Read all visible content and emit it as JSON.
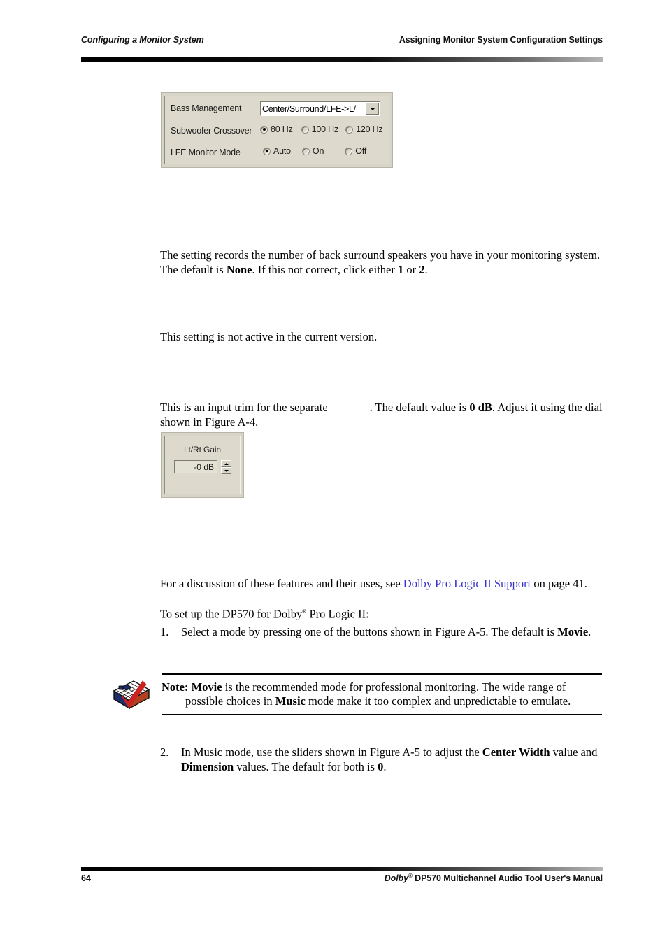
{
  "header": {
    "left": "Configuring a Monitor System",
    "right": "Assigning Monitor System Configuration Settings"
  },
  "footer": {
    "page_number": "64",
    "brand": "Dolby",
    "registered_mark": "®",
    "manual_title": " DP570 Multichannel Audio Tool User's Manual"
  },
  "bass_dialog": {
    "name": "bass-management-dialog",
    "rows": [
      {
        "label": "Bass Management",
        "control": "dropdown",
        "value": "Center/Surround/LFE->L/"
      },
      {
        "label": "Subwoofer Crossover",
        "control": "radio-group",
        "options": [
          {
            "label": "80 Hz",
            "checked": true
          },
          {
            "label": "100 Hz",
            "checked": false
          },
          {
            "label": "120 Hz",
            "checked": false
          }
        ]
      },
      {
        "label": "LFE Monitor Mode",
        "control": "radio-group",
        "options": [
          {
            "label": "Auto",
            "checked": true
          },
          {
            "label": "On",
            "checked": false
          },
          {
            "label": "Off",
            "checked": false
          }
        ]
      }
    ]
  },
  "gain_dialog": {
    "name": "lt-rt-gain-dialog",
    "caption": "Lt/Rt Gain",
    "value": "-0 dB",
    "spinner_up": "▲",
    "spinner_down": "▼"
  },
  "paragraphs": {
    "back_surround": {
      "seg1": "The setting records the number of back surround speakers you have in your monitoring system. The default is ",
      "bold1": "None",
      "seg2": ". If this not correct, click either ",
      "bold2": "1",
      "seg3": " or ",
      "bold3": "2",
      "seg4": "."
    },
    "not_active": "This setting is not active in the current version.",
    "input_trim": {
      "seg1": "This is an input trim for the separate",
      "seg2": ". The default value is ",
      "bold1": "0 dB",
      "seg3": ". Adjust it using the dial shown in Figure A-4."
    },
    "discussion": {
      "seg1": "For a discussion of these features and their uses, see ",
      "link": "Dolby Pro Logic II Support",
      "seg2": " on page 41."
    },
    "setup_intro": {
      "seg1": "To set up the DP570 for Dolby",
      "sup": "®",
      "seg2": " Pro Logic II:"
    }
  },
  "steps": [
    {
      "marker": "1.",
      "seg1": "Select a mode by pressing one of the buttons shown in Figure A-5. The default is ",
      "bold1": "Movie",
      "seg2": "."
    },
    {
      "marker": "2.",
      "seg1": "In Music mode, use the sliders shown in Figure A-5 to adjust the ",
      "bold1": "Center Width",
      "seg2": " value and ",
      "bold2": "Dimension",
      "seg3": " values. The default for both is ",
      "bold3": "0",
      "seg4": "."
    }
  ],
  "note": {
    "icon_name": "note-clipboard-checkmark-icon",
    "label": "Note:",
    "bold_mode": "Movie",
    "seg1": " is the recommended mode for professional monitoring. The wide range of",
    "line2_seg1": "possible choices in ",
    "line2_bold": "Music",
    "line2_seg2": " mode make it too complex and unpredictable to emulate."
  },
  "colors": {
    "link": "#3333cc",
    "dialog_face": "#d7d4c8",
    "dialog_inner": "#ddd9cc",
    "note_check": "#cc2222"
  }
}
